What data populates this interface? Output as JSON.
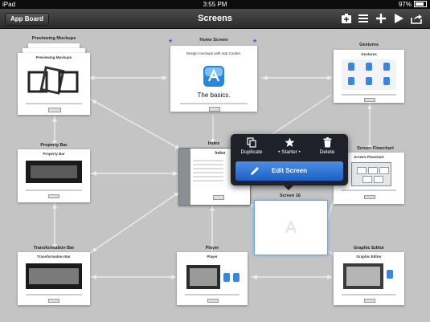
{
  "status_bar": {
    "device": "iPad",
    "time": "3:55 PM",
    "battery": "97%"
  },
  "nav": {
    "back_label": "App Board",
    "title": "Screens"
  },
  "cards": {
    "previewing": {
      "label": "Previewing Mockups",
      "title": "Previewing Mockups"
    },
    "home": {
      "label": "Home Screen",
      "line": "Design mockups with App Cooker.",
      "big": "The basics."
    },
    "gestures": {
      "label": "Gestures",
      "title": "Gestures"
    },
    "property": {
      "label": "Property Bar",
      "title": "Property Bar"
    },
    "index": {
      "label": "Index",
      "title": "Index"
    },
    "flowchart": {
      "label": "Screen Flowchart",
      "title": "Screen Flowchart"
    },
    "screen16": {
      "label": "Screen 16"
    },
    "transformation": {
      "label": "Transformation Bar",
      "title": "Transformation Bar"
    },
    "player": {
      "label": "Player",
      "title": "Player"
    },
    "graphic": {
      "label": "Graphic Editor",
      "title": "Graphic Editor"
    }
  },
  "popover": {
    "duplicate": "Duplicate",
    "starter": "• Starter •",
    "delete": "Delete",
    "edit": "Edit Screen"
  },
  "colors": {
    "accent": "#2c6fd0",
    "navbar": "#3a3a3a",
    "canvas": "#c4c4c4"
  }
}
